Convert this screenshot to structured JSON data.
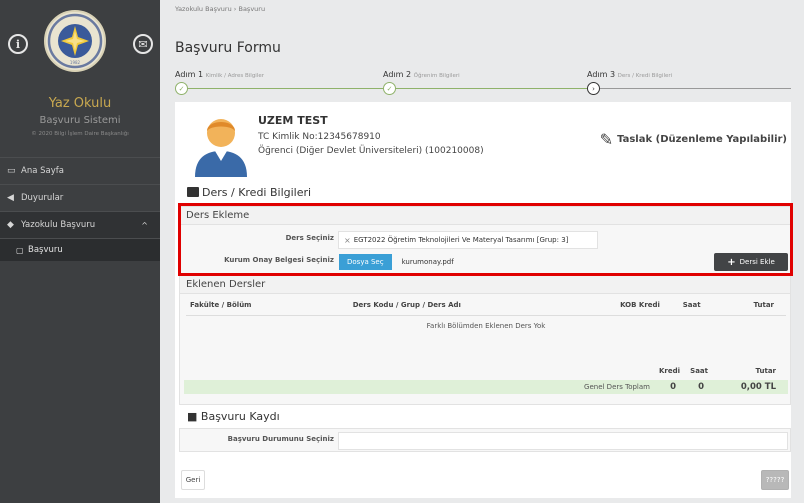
{
  "sidebar": {
    "app_title": "Yaz Okulu",
    "app_subtitle": "Başvuru Sistemi",
    "copyright": "© 2020 Bilgi İşlem Daire Başkanlığı",
    "logo_year": "1982",
    "items": [
      {
        "label": "Ana Sayfa",
        "icon": "monitor-icon"
      },
      {
        "label": "Duyurular",
        "icon": "bullhorn-icon"
      },
      {
        "label": "Yazokulu Başvuru",
        "icon": "graduation-cap-icon"
      }
    ],
    "subitems": [
      {
        "label": "Başvuru",
        "icon": "file-icon"
      }
    ]
  },
  "breadcrumb": {
    "root": "Yazokulu Başvuru",
    "separator": "›",
    "current": "Başvuru"
  },
  "page_title": "Başvuru Formu",
  "steps": [
    {
      "label": "Adım 1",
      "sub": "Kimlik / Adres Bilgiler"
    },
    {
      "label": "Adım 2",
      "sub": "Öğrenim Bilgileri"
    },
    {
      "label": "Adım 3",
      "sub": "Ders / Kredi Bilgileri"
    }
  ],
  "profile": {
    "name": "UZEM TEST",
    "tc": "TC Kimlik No:12345678910",
    "type": "Öğrenci (Diğer Devlet Üniversiteleri) (100210008)",
    "status": "Taslak (Düzenleme Yapılabilir)"
  },
  "ders_kredi": {
    "title": "Ders / Kredi Bilgileri",
    "ekleme": {
      "title": "Ders Ekleme",
      "ders_label": "Ders Seçiniz",
      "ders_value": "EGT2022 Öğretim Teknolojileri Ve Materyal Tasarımı [Grup: 3]",
      "onay_label": "Kurum Onay Belgesi Seçiniz",
      "file_button": "Dosya Seç",
      "file_name": "kurumonay.pdf",
      "add_button": "Dersi Ekle"
    },
    "eklenen": {
      "title": "Eklenen Dersler",
      "headers": [
        "Fakülte / Bölüm",
        "Ders Kodu / Grup / Ders Adı",
        "KOB Kredi",
        "Saat",
        "Tutar"
      ],
      "empty": "Farklı Bölümden Eklenen Ders Yok",
      "totals_headers": [
        "Kredi",
        "Saat",
        "Tutar"
      ],
      "totals_label": "Genel Ders Toplam",
      "totals": [
        "0",
        "0",
        "0,00 TL"
      ]
    }
  },
  "basvuru_kaydi": {
    "title": "Başvuru Kaydı",
    "durum_label": "Başvuru Durumunu Seçiniz",
    "durum_value": ""
  },
  "buttons": {
    "back": "Geri",
    "submit": "?????"
  },
  "colors": {
    "sidebar": "#3d3f41",
    "accent_gold": "#c8a850",
    "file_button": "#3a9fd6",
    "success": "#8fb26a",
    "highlight": "#e00000"
  }
}
